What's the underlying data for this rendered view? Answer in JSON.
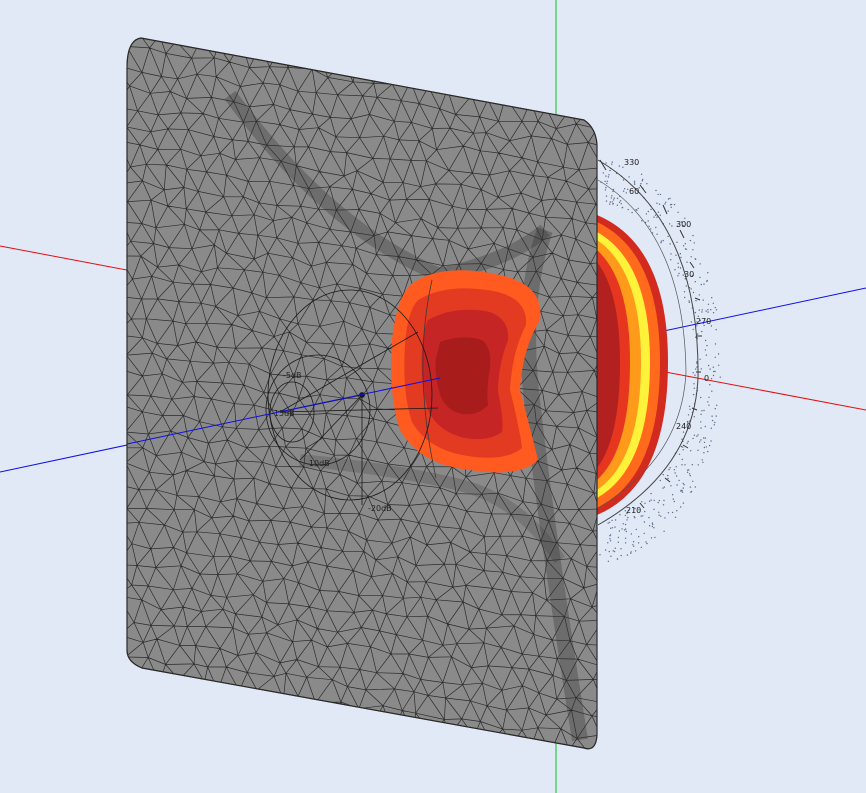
{
  "scene": {
    "background_color": "#e1e9f6",
    "plate_color": "#8a8a8a",
    "mesh_line_color": "#2b2b2b",
    "axis_colors": {
      "x": "#e01010",
      "y": "#10c020",
      "z": "#1010e0"
    },
    "heat_colors": [
      "#a81c1c",
      "#c62525",
      "#e33a22",
      "#ff5a1f",
      "#ff8c1a",
      "#ffd51a",
      "#fff23a"
    ]
  },
  "polar_scale": {
    "angle_labels": [
      "330",
      "60",
      "300",
      "30",
      "270",
      "0",
      "240",
      "210"
    ]
  },
  "db_rings": {
    "labels": [
      "-5dB",
      "-15dB",
      "-10dB",
      "-20dB"
    ]
  }
}
